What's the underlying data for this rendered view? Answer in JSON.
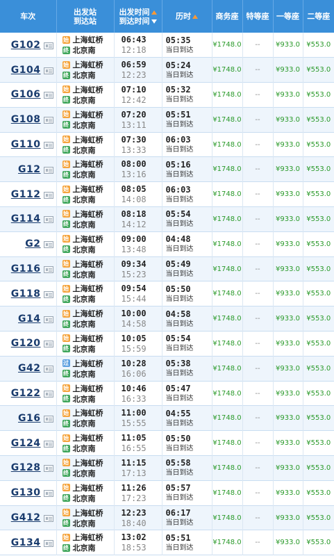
{
  "header": {
    "train": "车次",
    "stations_line1": "出发站",
    "stations_line2": "到达站",
    "times_line1": "出发时间",
    "times_line2": "到达时间",
    "duration": "历时",
    "business": "商务座",
    "special": "特等座",
    "first": "一等座",
    "second": "二等座"
  },
  "badges": {
    "start": "始",
    "pass": "过",
    "end": "终"
  },
  "rows": [
    {
      "train": "G102",
      "from_type": "start",
      "from": "上海虹桥",
      "to": "北京南",
      "dep": "06:43",
      "arr": "12:18",
      "dur": "05:35",
      "day": "当日到达",
      "business": "¥1748.0",
      "special": "--",
      "first": "¥933.0",
      "second": "¥553.0"
    },
    {
      "train": "G104",
      "from_type": "start",
      "from": "上海虹桥",
      "to": "北京南",
      "dep": "06:59",
      "arr": "12:23",
      "dur": "05:24",
      "day": "当日到达",
      "business": "¥1748.0",
      "special": "--",
      "first": "¥933.0",
      "second": "¥553.0"
    },
    {
      "train": "G106",
      "from_type": "start",
      "from": "上海虹桥",
      "to": "北京南",
      "dep": "07:10",
      "arr": "12:42",
      "dur": "05:32",
      "day": "当日到达",
      "business": "¥1748.0",
      "special": "--",
      "first": "¥933.0",
      "second": "¥553.0"
    },
    {
      "train": "G108",
      "from_type": "start",
      "from": "上海虹桥",
      "to": "北京南",
      "dep": "07:20",
      "arr": "13:11",
      "dur": "05:51",
      "day": "当日到达",
      "business": "¥1748.0",
      "special": "--",
      "first": "¥933.0",
      "second": "¥553.0"
    },
    {
      "train": "G110",
      "from_type": "start",
      "from": "上海虹桥",
      "to": "北京南",
      "dep": "07:30",
      "arr": "13:33",
      "dur": "06:03",
      "day": "当日到达",
      "business": "¥1748.0",
      "special": "--",
      "first": "¥933.0",
      "second": "¥553.0"
    },
    {
      "train": "G12",
      "from_type": "start",
      "from": "上海虹桥",
      "to": "北京南",
      "dep": "08:00",
      "arr": "13:16",
      "dur": "05:16",
      "day": "当日到达",
      "business": "¥1748.0",
      "special": "--",
      "first": "¥933.0",
      "second": "¥553.0"
    },
    {
      "train": "G112",
      "from_type": "start",
      "from": "上海虹桥",
      "to": "北京南",
      "dep": "08:05",
      "arr": "14:08",
      "dur": "06:03",
      "day": "当日到达",
      "business": "¥1748.0",
      "special": "--",
      "first": "¥933.0",
      "second": "¥553.0"
    },
    {
      "train": "G114",
      "from_type": "start",
      "from": "上海虹桥",
      "to": "北京南",
      "dep": "08:18",
      "arr": "14:12",
      "dur": "05:54",
      "day": "当日到达",
      "business": "¥1748.0",
      "special": "--",
      "first": "¥933.0",
      "second": "¥553.0"
    },
    {
      "train": "G2",
      "from_type": "start",
      "from": "上海虹桥",
      "to": "北京南",
      "dep": "09:00",
      "arr": "13:48",
      "dur": "04:48",
      "day": "当日到达",
      "business": "¥1748.0",
      "special": "--",
      "first": "¥933.0",
      "second": "¥553.0"
    },
    {
      "train": "G116",
      "from_type": "start",
      "from": "上海虹桥",
      "to": "北京南",
      "dep": "09:34",
      "arr": "15:23",
      "dur": "05:49",
      "day": "当日到达",
      "business": "¥1748.0",
      "special": "--",
      "first": "¥933.0",
      "second": "¥553.0"
    },
    {
      "train": "G118",
      "from_type": "start",
      "from": "上海虹桥",
      "to": "北京南",
      "dep": "09:54",
      "arr": "15:44",
      "dur": "05:50",
      "day": "当日到达",
      "business": "¥1748.0",
      "special": "--",
      "first": "¥933.0",
      "second": "¥553.0"
    },
    {
      "train": "G14",
      "from_type": "start",
      "from": "上海虹桥",
      "to": "北京南",
      "dep": "10:00",
      "arr": "14:58",
      "dur": "04:58",
      "day": "当日到达",
      "business": "¥1748.0",
      "special": "--",
      "first": "¥933.0",
      "second": "¥553.0"
    },
    {
      "train": "G120",
      "from_type": "start",
      "from": "上海虹桥",
      "to": "北京南",
      "dep": "10:05",
      "arr": "15:59",
      "dur": "05:54",
      "day": "当日到达",
      "business": "¥1748.0",
      "special": "--",
      "first": "¥933.0",
      "second": "¥553.0"
    },
    {
      "train": "G42",
      "from_type": "pass",
      "from": "上海虹桥",
      "to": "北京南",
      "dep": "10:28",
      "arr": "16:06",
      "dur": "05:38",
      "day": "当日到达",
      "business": "¥1748.0",
      "special": "--",
      "first": "¥933.0",
      "second": "¥553.0"
    },
    {
      "train": "G122",
      "from_type": "start",
      "from": "上海虹桥",
      "to": "北京南",
      "dep": "10:46",
      "arr": "16:33",
      "dur": "05:47",
      "day": "当日到达",
      "business": "¥1748.0",
      "special": "--",
      "first": "¥933.0",
      "second": "¥553.0"
    },
    {
      "train": "G16",
      "from_type": "start",
      "from": "上海虹桥",
      "to": "北京南",
      "dep": "11:00",
      "arr": "15:55",
      "dur": "04:55",
      "day": "当日到达",
      "business": "¥1748.0",
      "special": "--",
      "first": "¥933.0",
      "second": "¥553.0"
    },
    {
      "train": "G124",
      "from_type": "start",
      "from": "上海虹桥",
      "to": "北京南",
      "dep": "11:05",
      "arr": "16:55",
      "dur": "05:50",
      "day": "当日到达",
      "business": "¥1748.0",
      "special": "--",
      "first": "¥933.0",
      "second": "¥553.0"
    },
    {
      "train": "G128",
      "from_type": "start",
      "from": "上海虹桥",
      "to": "北京南",
      "dep": "11:15",
      "arr": "17:13",
      "dur": "05:58",
      "day": "当日到达",
      "business": "¥1748.0",
      "special": "--",
      "first": "¥933.0",
      "second": "¥553.0"
    },
    {
      "train": "G130",
      "from_type": "start",
      "from": "上海虹桥",
      "to": "北京南",
      "dep": "11:26",
      "arr": "17:23",
      "dur": "05:57",
      "day": "当日到达",
      "business": "¥1748.0",
      "special": "--",
      "first": "¥933.0",
      "second": "¥553.0"
    },
    {
      "train": "G412",
      "from_type": "start",
      "from": "上海虹桥",
      "to": "北京南",
      "dep": "12:23",
      "arr": "18:40",
      "dur": "06:17",
      "day": "当日到达",
      "business": "¥1748.0",
      "special": "--",
      "first": "¥933.0",
      "second": "¥553.0"
    },
    {
      "train": "G134",
      "from_type": "start",
      "from": "上海虹桥",
      "to": "北京南",
      "dep": "13:02",
      "arr": "18:53",
      "dur": "05:51",
      "day": "当日到达",
      "business": "¥1748.0",
      "special": "--",
      "first": "¥933.0",
      "second": "¥553.0"
    }
  ]
}
